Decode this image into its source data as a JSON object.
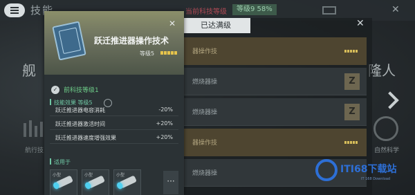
{
  "topbar": {
    "title": "技能",
    "current_level_label": "当前科技等级",
    "level_badge": "等级9 58%"
  },
  "side": {
    "left_title": "舰",
    "right_title": "隆人",
    "left_label": "航行技",
    "right_label": "自然科学"
  },
  "panel": {
    "header": "已达满级",
    "rows": [
      {
        "label": "器操作技",
        "style": "gold"
      },
      {
        "label": "燃烧器操",
        "style": "dark"
      },
      {
        "label": "燃烧器操",
        "style": "dark"
      },
      {
        "label": "器操作技",
        "style": "gold"
      },
      {
        "label": "燃烧器操",
        "style": "dark"
      }
    ]
  },
  "card": {
    "title": "跃迁推进器操作技术",
    "level": "等级5",
    "check_label": "前科技等级1",
    "effect_header": "技能效果 等级5",
    "effects": [
      {
        "name": "跃迁推进器电容消耗",
        "value": "-20%"
      },
      {
        "name": "跃迁推进器激活时间",
        "value": "+20%"
      },
      {
        "name": "跃迁推进器速度增强效果",
        "value": "+20%"
      }
    ],
    "apply_header": "适用于",
    "ships": [
      {
        "label": "小型"
      },
      {
        "label": "小型"
      },
      {
        "label": "小型"
      }
    ],
    "more": "···",
    "close": "✕"
  },
  "watermark": {
    "text": "ITI68下载站",
    "sub": "IT 168 Download"
  },
  "colors": {
    "accent_green": "#6fc7a4",
    "gold": "#d7bd5a",
    "brand_blue": "#2d6fd6"
  }
}
